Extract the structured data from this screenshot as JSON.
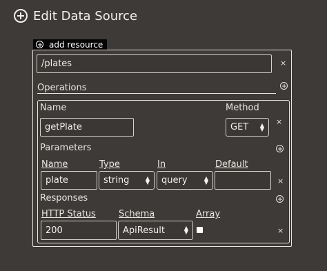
{
  "header": {
    "title": "Edit Data Source",
    "icon": "plus-circle-icon"
  },
  "add_resource": {
    "label": "add resource"
  },
  "resource": {
    "path": "/plates",
    "remove": "×"
  },
  "operations": {
    "label": "Operations",
    "name_label": "Name",
    "name_value": "getPlate",
    "method_label": "Method",
    "method_value": "GET",
    "remove": "×",
    "parameters": {
      "label": "Parameters",
      "columns": [
        "Name",
        "Type",
        "In",
        "Default"
      ],
      "row": {
        "name": "plate",
        "type": "string",
        "in": "query",
        "default": "",
        "remove": "×"
      }
    },
    "responses": {
      "label": "Responses",
      "columns": [
        "HTTP Status",
        "Schema",
        "Array"
      ],
      "row": {
        "status": "200",
        "schema": "ApiResult",
        "array_checked": false,
        "remove": "×"
      }
    }
  }
}
